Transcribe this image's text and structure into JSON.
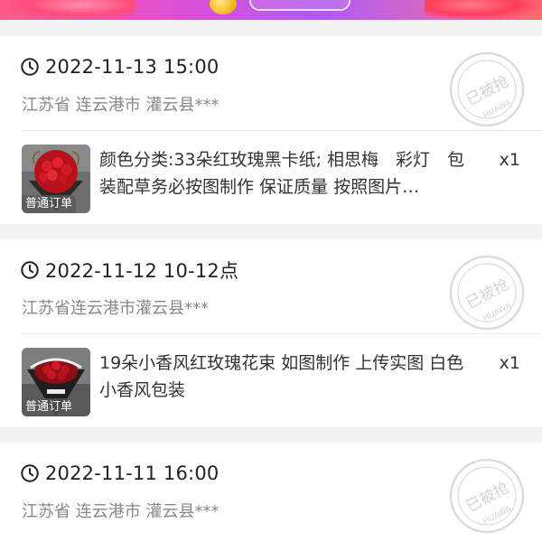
{
  "colors": {
    "banner": "#b05cf0",
    "stamp": "#d9d9d9",
    "text_primary": "#222222",
    "text_secondary": "#888888"
  },
  "orders": [
    {
      "time": "2022-11-13 15:00",
      "address": "江苏省 连云港市 灌云县***",
      "stamp_text": "已被抢",
      "stamp_subtext": "HUAWA",
      "thumb_tag": "普通订单",
      "title": "颜色分类:33朵红玫瑰黑卡纸; 相思梅　彩灯　包装配草务必按图制作 保证质量 按照图片…",
      "qty": "x1"
    },
    {
      "time": "2022-11-12 10-12点",
      "address": "江苏省连云港市灌云县***",
      "stamp_text": "已被抢",
      "stamp_subtext": "HUAWA",
      "thumb_tag": "普通订单",
      "title": "19朵小香风红玫瑰花束  如图制作 上传实图 白色小香风包装",
      "qty": "x1"
    },
    {
      "time": "2022-11-11 16:00",
      "address": "江苏省 连云港市 灌云县***",
      "stamp_text": "已被抢",
      "stamp_subtext": "HUAWA"
    }
  ]
}
